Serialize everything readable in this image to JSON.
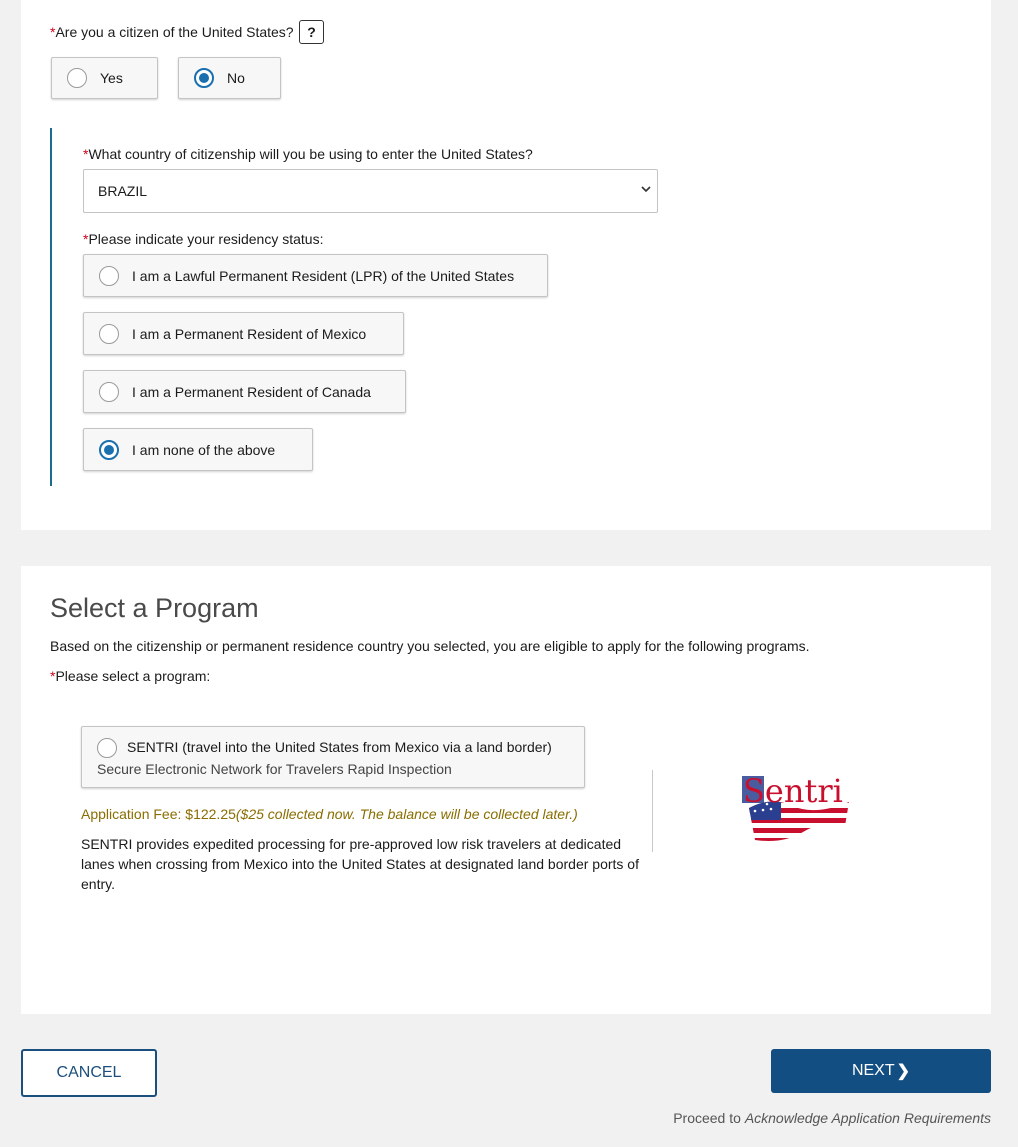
{
  "citizenship": {
    "required_mark": "*",
    "question": "Are you a citizen of the United States?",
    "help_label": "?",
    "options": [
      {
        "label": "Yes",
        "selected": false
      },
      {
        "label": "No",
        "selected": true
      }
    ]
  },
  "country": {
    "required_mark": "*",
    "question": "What country of citizenship will you be using to enter the United States?",
    "selected": "BRAZIL"
  },
  "residency": {
    "required_mark": "*",
    "question": "Please indicate your residency status:",
    "options": [
      {
        "label": "I am a Lawful Permanent Resident (LPR) of the United States",
        "selected": false
      },
      {
        "label": "I am a Permanent Resident of Mexico",
        "selected": false
      },
      {
        "label": "I am a Permanent Resident of Canada",
        "selected": false
      },
      {
        "label": "I am none of the above",
        "selected": true
      }
    ]
  },
  "program": {
    "heading": "Select a Program",
    "intro": "Based on the citizenship or permanent residence country you selected, you are eligible to apply for the following programs.",
    "required_mark": "*",
    "prompt": "Please select a program:",
    "option": {
      "title": "SENTRI (travel into the United States from Mexico via a land border)",
      "subtitle": "Secure Electronic Network for Travelers Rapid Inspection",
      "selected": false
    },
    "fee_label": "Application Fee: $122.25",
    "fee_note": "($25 collected now. The balance will be collected later.)",
    "description": "SENTRI provides expedited processing for pre-approved low risk travelers at dedicated lanes when crossing from Mexico into the United States at designated land border ports of entry.",
    "logo_text": "Sentri"
  },
  "footer": {
    "cancel_label": "CANCEL",
    "next_label": "NEXT",
    "next_arrow": "❯",
    "proceed_prefix": "Proceed to ",
    "proceed_target": "Acknowledge Application Requirements"
  },
  "colors": {
    "primary": "#134e83",
    "radio_selected": "#1a6fae",
    "required": "#d0021b",
    "fee": "#8a6d00",
    "accent_bar": "#1c6c8c"
  }
}
